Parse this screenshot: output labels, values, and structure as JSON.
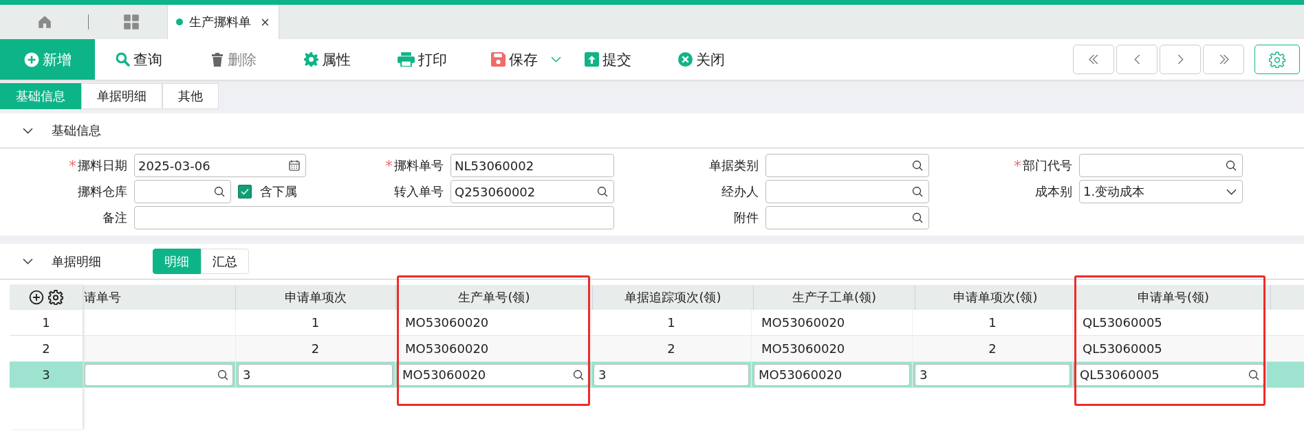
{
  "open_tabs": [
    {
      "label": "生产挪料单",
      "selected": true
    }
  ],
  "toolbar": [
    {
      "label": "新增",
      "kind": "plus",
      "primary": true,
      "disabled": false,
      "dropdown": false
    },
    {
      "label": "查询",
      "kind": "search",
      "primary": false,
      "disabled": false,
      "dropdown": false
    },
    {
      "label": "删除",
      "kind": "trash",
      "primary": false,
      "disabled": true,
      "dropdown": false
    },
    {
      "label": "属性",
      "kind": "gear",
      "primary": false,
      "disabled": false,
      "dropdown": false
    },
    {
      "label": "打印",
      "kind": "print",
      "primary": false,
      "disabled": false,
      "dropdown": false
    },
    {
      "label": "保存",
      "kind": "save",
      "primary": false,
      "disabled": false,
      "dropdown": true
    },
    {
      "label": "提交",
      "kind": "submit",
      "primary": false,
      "disabled": false,
      "dropdown": false
    },
    {
      "label": "关闭",
      "kind": "close",
      "primary": false,
      "disabled": false,
      "dropdown": false
    }
  ],
  "page_tabs": [
    {
      "label": "基础信息",
      "selected": true
    },
    {
      "label": "单据明细",
      "selected": false
    },
    {
      "label": "其他",
      "selected": false
    }
  ],
  "basic_section": {
    "title": "基础信息",
    "expanded": true,
    "fields": [
      {
        "label": "挪料日期",
        "required_mark": "*",
        "kind": "date",
        "value": "2025-03-06"
      },
      {
        "label": "挪料单号",
        "required_mark": "*",
        "kind": "text",
        "value": "NL53060002"
      },
      {
        "label": "单据类别",
        "kind": "lookup"
      },
      {
        "label": "部门代号",
        "required_mark": "*",
        "kind": "lookup"
      },
      {
        "label": "挪料仓库",
        "kind": "lookup",
        "option": {
          "label": "含下属",
          "checked": true
        }
      },
      {
        "label": "转入单号",
        "kind": "lookup",
        "value": "Q253060002"
      },
      {
        "label": "经办人",
        "kind": "lookup"
      },
      {
        "label": "成本别",
        "kind": "select",
        "value": "1.变动成本"
      },
      {
        "label": "备注",
        "kind": "wide"
      },
      {
        "label": "附件",
        "kind": "lookup"
      }
    ]
  },
  "detail_section": {
    "title": "单据明细",
    "expanded": true,
    "view_tabs": [
      {
        "label": "明细",
        "selected": true
      },
      {
        "label": "汇总",
        "selected": false
      }
    ],
    "table": {
      "columns": [
        {
          "header": "请单号",
          "kind": "lookup",
          "highlighted": false
        },
        {
          "header": "申请单项次",
          "kind": "number",
          "highlighted": false
        },
        {
          "header": "生产单号(领)",
          "kind": "lookup",
          "highlighted": true
        },
        {
          "header": "单据追踪项次(领)",
          "kind": "number",
          "highlighted": false
        },
        {
          "header": "生产子工单(领)",
          "kind": "text",
          "highlighted": false
        },
        {
          "header": "申请单项次(领)",
          "kind": "number",
          "highlighted": false
        },
        {
          "header": "申请单号(领)",
          "kind": "lookup",
          "highlighted": true
        }
      ],
      "rows": [
        {
          "index": "1",
          "selected": false,
          "cells": [
            null,
            "1",
            "MO53060020",
            "1",
            "MO53060020",
            "1",
            "QL53060005"
          ]
        },
        {
          "index": "2",
          "selected": false,
          "cells": [
            null,
            "2",
            "MO53060020",
            "2",
            "MO53060020",
            "2",
            "QL53060005"
          ]
        },
        {
          "index": "3",
          "selected": true,
          "cells": [
            null,
            "3",
            "MO53060020",
            "3",
            "MO53060020",
            "3",
            "QL53060005"
          ]
        }
      ]
    }
  }
}
